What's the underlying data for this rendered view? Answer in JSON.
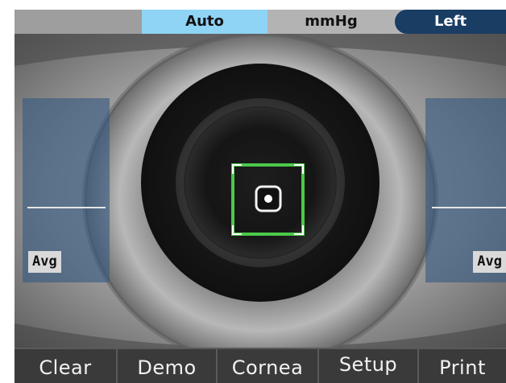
{
  "top_bar": {
    "mode": "Auto",
    "unit": "mmHg",
    "eye": "Left"
  },
  "left_panel": {
    "avg_label": "Avg"
  },
  "right_panel": {
    "avg_label": "Avg"
  },
  "menu": {
    "clear": "Clear",
    "demo": "Demo",
    "cornea": "Cornea",
    "setup": "Setup",
    "print": "Print"
  },
  "colors": {
    "mode_highlight": "#8fd3f5",
    "eye_badge": "#1a3d63",
    "alignment_frame": "#4cc94a",
    "panel_overlay": "#375a82"
  }
}
